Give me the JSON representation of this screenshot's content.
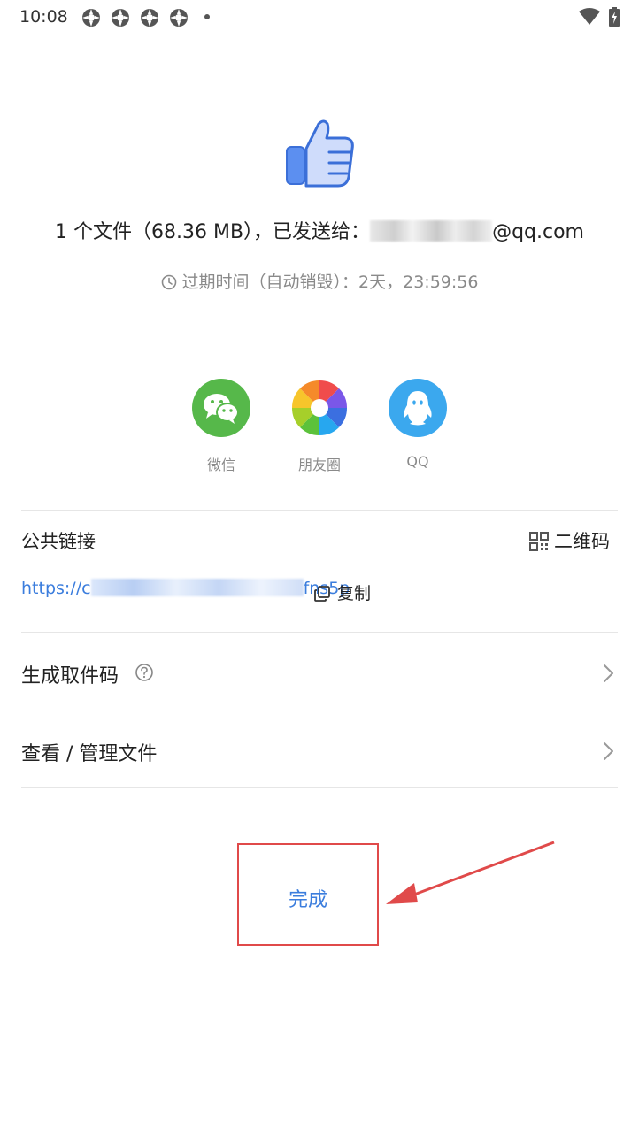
{
  "status_bar": {
    "time": "10:08"
  },
  "transfer": {
    "sent_prefix": "1 个文件（68.36 MB），已发送给：",
    "recipient_visible": "@qq.com",
    "expire_text": "过期时间（自动销毁）：2天，23:59:56"
  },
  "share": {
    "items": [
      {
        "label": "微信",
        "icon": "wechat-icon",
        "color": "#56b84a"
      },
      {
        "label": "朋友圈",
        "icon": "moments-icon",
        "color": "#ffffff"
      },
      {
        "label": "QQ",
        "icon": "qq-icon",
        "color": "#3ba8ee"
      }
    ]
  },
  "public_link": {
    "title": "公共链接",
    "qr_label": "二维码",
    "url_prefix": "https://c",
    "url_suffix": "fns5p",
    "copy_label": "复制"
  },
  "rows": {
    "pickup_code": "生成取件码",
    "manage_files": "查看 / 管理文件"
  },
  "done_label": "完成",
  "colors": {
    "accent": "#3b7ddd",
    "highlight": "#e04a4a"
  }
}
